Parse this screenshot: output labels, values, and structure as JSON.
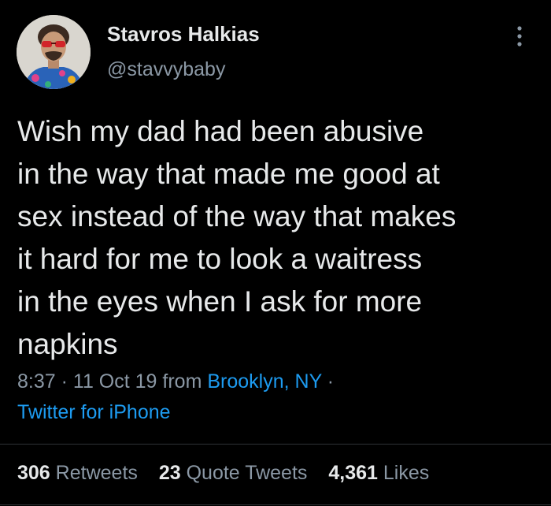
{
  "author": {
    "name": "Stavros Halkias",
    "handle": "@stavvybaby"
  },
  "tweet": {
    "lines": [
      "Wish my dad had been abusive",
      "in the way that made me good at",
      "sex instead of the way that makes",
      "it hard for me to look a waitress",
      "in the eyes when I ask for more",
      "napkins"
    ],
    "time": "8:37",
    "separator": "·",
    "date": "11 Oct 19",
    "from_label": "from",
    "location": "Brooklyn, NY",
    "source": "Twitter for iPhone"
  },
  "stats": {
    "retweets_count": "306",
    "retweets_label": "Retweets",
    "quotes_count": "23",
    "quotes_label": "Quote Tweets",
    "likes_count": "4,361",
    "likes_label": "Likes"
  },
  "icons": {
    "more": "more-vertical-icon"
  },
  "colors": {
    "background": "#000000",
    "text": "#e7e9ea",
    "secondary": "#8b98a5",
    "link": "#1d9bf0",
    "divider": "#2f3336"
  }
}
